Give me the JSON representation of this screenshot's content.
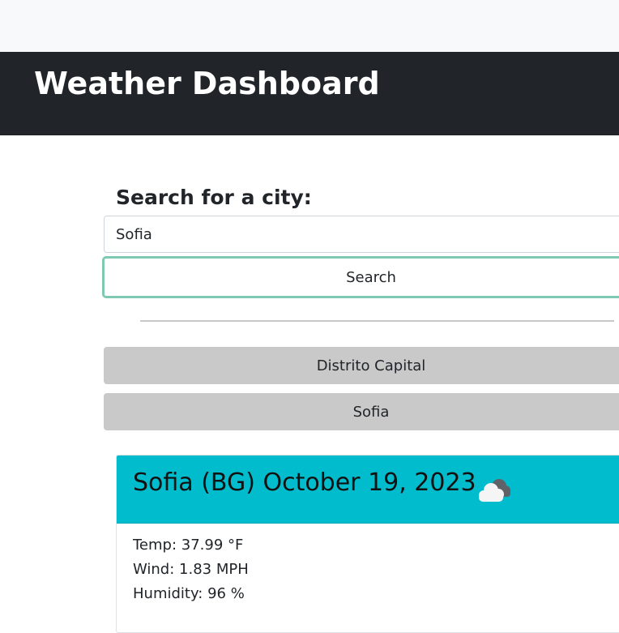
{
  "header": {
    "title": "Weather Dashboard"
  },
  "search": {
    "label": "Search for a city:",
    "input_value": "Sofia",
    "button_label": "Search"
  },
  "history": {
    "items": [
      {
        "label": "Distrito Capital"
      },
      {
        "label": "Sofia"
      }
    ]
  },
  "current": {
    "title": "Sofia (BG) October 19, 2023",
    "icon": "cloud-icon",
    "temp": "Temp: 37.99 °F",
    "wind": "Wind: 1.83 MPH",
    "humidity": "Humidity: 96 %"
  },
  "colors": {
    "header_bg": "#212529",
    "card_header_bg": "#00bccc",
    "history_button_bg": "#c9c9c9",
    "search_button_border": "#7fc9b3"
  }
}
